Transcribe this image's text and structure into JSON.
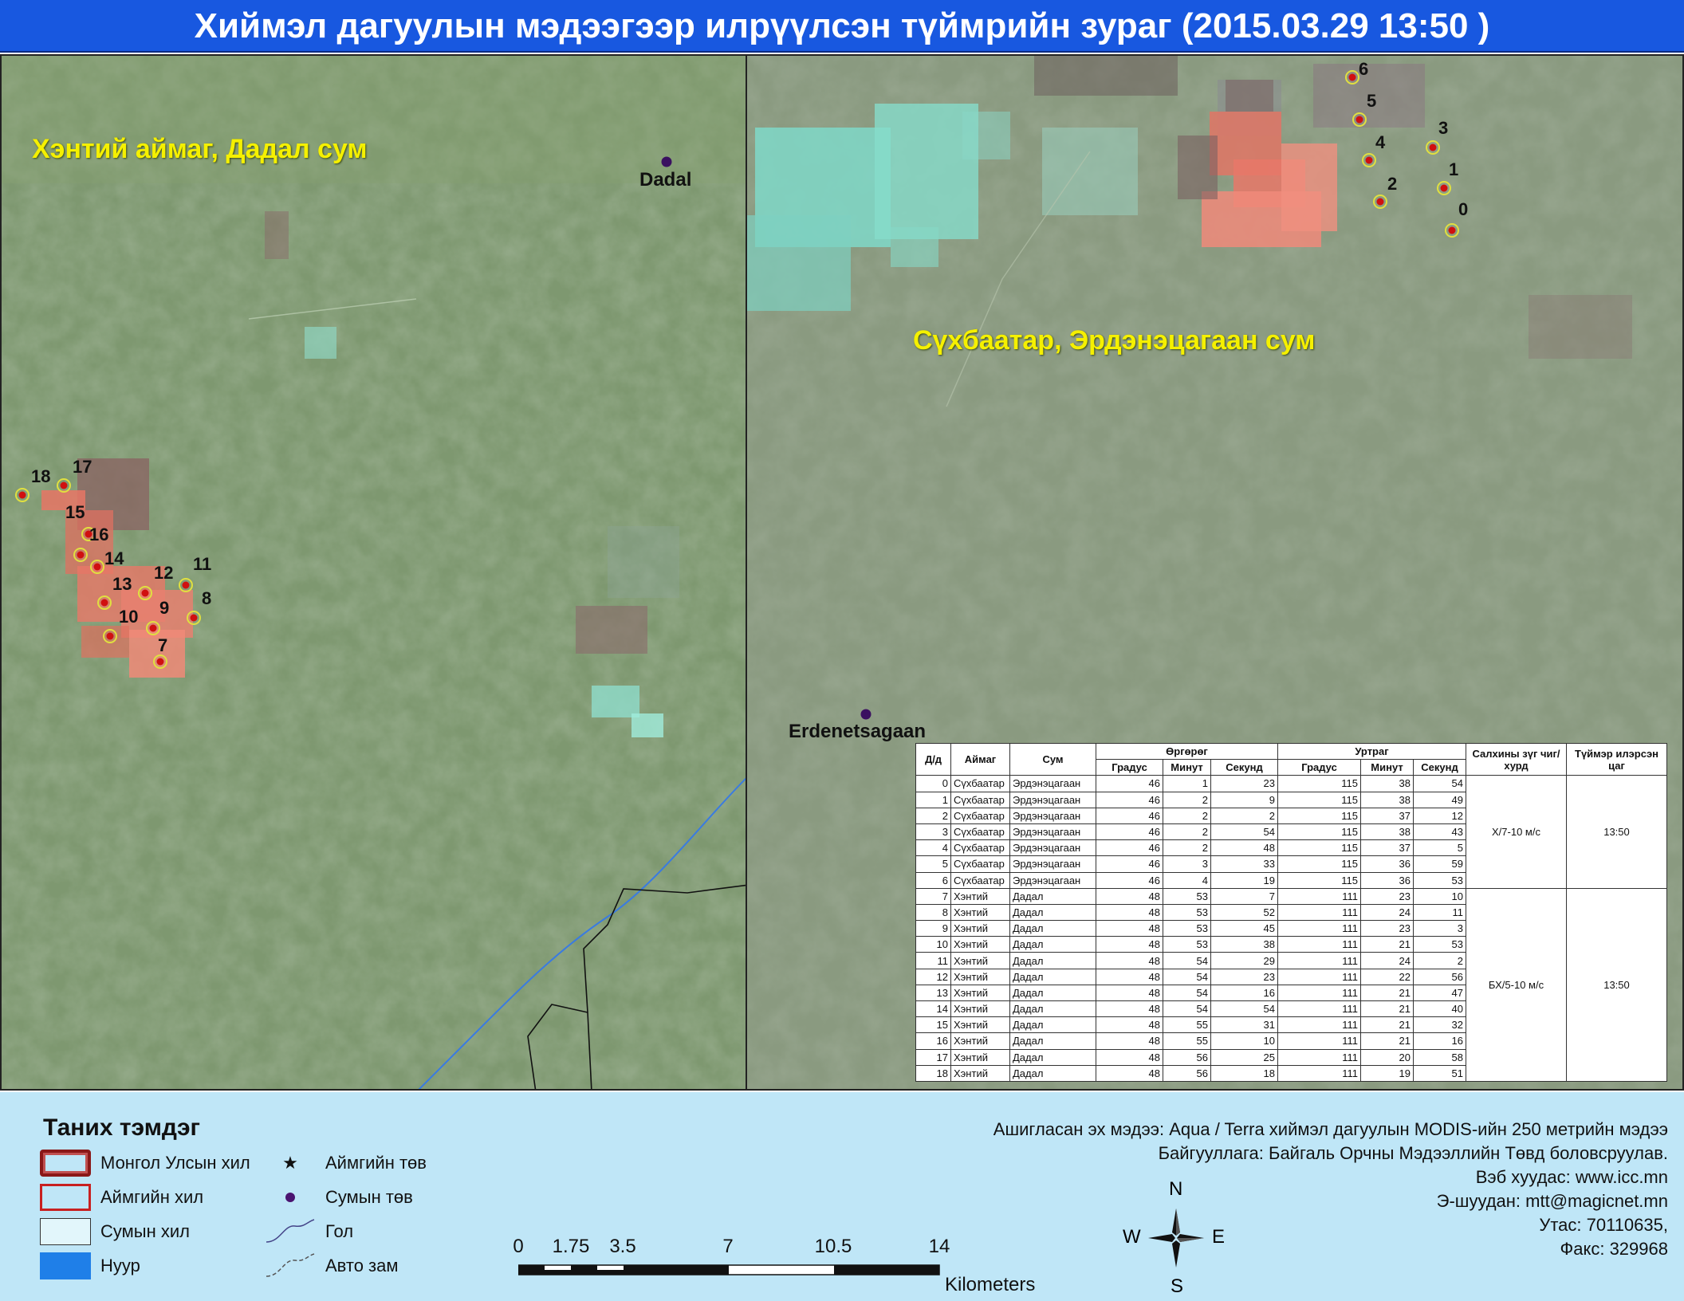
{
  "title": "Хиймэл дагуулын мэдээгээр илрүүлсэн түймрийн зураг  (2015.03.29 13:50 )",
  "map_left": {
    "region_label": "Хэнтий аймаг, Дадал сум",
    "town_label": "Dadal",
    "fire_labels": [
      "7",
      "8",
      "9",
      "10",
      "11",
      "12",
      "13",
      "14",
      "15",
      "16",
      "17",
      "18"
    ]
  },
  "map_right": {
    "region_label": "Сүхбаатар, Эрдэнэцагаан сум",
    "town_label": "Erdenetsagaan",
    "fire_labels": [
      "0",
      "1",
      "2",
      "3",
      "4",
      "5",
      "6"
    ]
  },
  "table": {
    "headers": {
      "id": "Д/д",
      "aimag": "Аймаг",
      "sum": "Сум",
      "lat": "Өргөрөг",
      "lon": "Уртраг",
      "deg": "Градус",
      "min": "Минут",
      "sec": "Секунд",
      "wind": "Салхины зүг чиг/хурд",
      "time": "Түймэр илэрсэн цаг"
    },
    "rows": [
      {
        "id": "0",
        "aimag": "Сүхбаатар",
        "sum": "Эрдэнэцагаан",
        "lat_d": "46",
        "lat_m": "1",
        "lat_s": "23",
        "lon_d": "115",
        "lon_m": "38",
        "lon_s": "54"
      },
      {
        "id": "1",
        "aimag": "Сүхбаатар",
        "sum": "Эрдэнэцагаан",
        "lat_d": "46",
        "lat_m": "2",
        "lat_s": "9",
        "lon_d": "115",
        "lon_m": "38",
        "lon_s": "49"
      },
      {
        "id": "2",
        "aimag": "Сүхбаатар",
        "sum": "Эрдэнэцагаан",
        "lat_d": "46",
        "lat_m": "2",
        "lat_s": "2",
        "lon_d": "115",
        "lon_m": "37",
        "lon_s": "12"
      },
      {
        "id": "3",
        "aimag": "Сүхбаатар",
        "sum": "Эрдэнэцагаан",
        "lat_d": "46",
        "lat_m": "2",
        "lat_s": "54",
        "lon_d": "115",
        "lon_m": "38",
        "lon_s": "43"
      },
      {
        "id": "4",
        "aimag": "Сүхбаатар",
        "sum": "Эрдэнэцагаан",
        "lat_d": "46",
        "lat_m": "2",
        "lat_s": "48",
        "lon_d": "115",
        "lon_m": "37",
        "lon_s": "5"
      },
      {
        "id": "5",
        "aimag": "Сүхбаатар",
        "sum": "Эрдэнэцагаан",
        "lat_d": "46",
        "lat_m": "3",
        "lat_s": "33",
        "lon_d": "115",
        "lon_m": "36",
        "lon_s": "59"
      },
      {
        "id": "6",
        "aimag": "Сүхбаатар",
        "sum": "Эрдэнэцагаан",
        "lat_d": "46",
        "lat_m": "4",
        "lat_s": "19",
        "lon_d": "115",
        "lon_m": "36",
        "lon_s": "53"
      },
      {
        "id": "7",
        "aimag": "Хэнтий",
        "sum": "Дадал",
        "lat_d": "48",
        "lat_m": "53",
        "lat_s": "7",
        "lon_d": "111",
        "lon_m": "23",
        "lon_s": "10"
      },
      {
        "id": "8",
        "aimag": "Хэнтий",
        "sum": "Дадал",
        "lat_d": "48",
        "lat_m": "53",
        "lat_s": "52",
        "lon_d": "111",
        "lon_m": "24",
        "lon_s": "11"
      },
      {
        "id": "9",
        "aimag": "Хэнтий",
        "sum": "Дадал",
        "lat_d": "48",
        "lat_m": "53",
        "lat_s": "45",
        "lon_d": "111",
        "lon_m": "23",
        "lon_s": "3"
      },
      {
        "id": "10",
        "aimag": "Хэнтий",
        "sum": "Дадал",
        "lat_d": "48",
        "lat_m": "53",
        "lat_s": "38",
        "lon_d": "111",
        "lon_m": "21",
        "lon_s": "53"
      },
      {
        "id": "11",
        "aimag": "Хэнтий",
        "sum": "Дадал",
        "lat_d": "48",
        "lat_m": "54",
        "lat_s": "29",
        "lon_d": "111",
        "lon_m": "24",
        "lon_s": "2"
      },
      {
        "id": "12",
        "aimag": "Хэнтий",
        "sum": "Дадал",
        "lat_d": "48",
        "lat_m": "54",
        "lat_s": "23",
        "lon_d": "111",
        "lon_m": "22",
        "lon_s": "56"
      },
      {
        "id": "13",
        "aimag": "Хэнтий",
        "sum": "Дадал",
        "lat_d": "48",
        "lat_m": "54",
        "lat_s": "16",
        "lon_d": "111",
        "lon_m": "21",
        "lon_s": "47"
      },
      {
        "id": "14",
        "aimag": "Хэнтий",
        "sum": "Дадал",
        "lat_d": "48",
        "lat_m": "54",
        "lat_s": "54",
        "lon_d": "111",
        "lon_m": "21",
        "lon_s": "40"
      },
      {
        "id": "15",
        "aimag": "Хэнтий",
        "sum": "Дадал",
        "lat_d": "48",
        "lat_m": "55",
        "lat_s": "31",
        "lon_d": "111",
        "lon_m": "21",
        "lon_s": "32"
      },
      {
        "id": "16",
        "aimag": "Хэнтий",
        "sum": "Дадал",
        "lat_d": "48",
        "lat_m": "55",
        "lat_s": "10",
        "lon_d": "111",
        "lon_m": "21",
        "lon_s": "16"
      },
      {
        "id": "17",
        "aimag": "Хэнтий",
        "sum": "Дадал",
        "lat_d": "48",
        "lat_m": "56",
        "lat_s": "25",
        "lon_d": "111",
        "lon_m": "20",
        "lon_s": "58"
      },
      {
        "id": "18",
        "aimag": "Хэнтий",
        "sum": "Дадал",
        "lat_d": "48",
        "lat_m": "56",
        "lat_s": "18",
        "lon_d": "111",
        "lon_m": "19",
        "lon_s": "51"
      }
    ],
    "group1": {
      "wind": "Х/7-10 м/с",
      "time": "13:50"
    },
    "group2": {
      "wind": "БХ/5-10 м/с",
      "time": "13:50"
    }
  },
  "legend": {
    "title": "Таних тэмдэг",
    "items": {
      "border_national": "Монгол Улсын хил",
      "border_aimag": "Аймгийн хил",
      "border_sum": "Сумын хил",
      "lake": "Нуур",
      "aimag_center": "Аймгийн төв",
      "sum_center": "Сумын төв",
      "river": "Гол",
      "road": "Авто зам"
    }
  },
  "scalebar": {
    "ticks": [
      "0",
      "1.75",
      "3.5",
      "7",
      "10.5",
      "14"
    ],
    "unit": "Kilometers"
  },
  "compass": {
    "n": "N",
    "s": "S",
    "e": "E",
    "w": "W"
  },
  "info": {
    "line1": "Ашигласан эх мэдээ: Aqua / Terra хиймэл дагуулын MODIS-ийн 250 метрийн мэдээ",
    "line2": "Байгууллага: Байгаль Орчны Мэдээллийн Төвд боловсруулав.",
    "line3": "Вэб хуудас: www.icc.mn",
    "line4": "Э-шуудан: mtt@magicnet.mn",
    "line5": "Утас: 70110635,",
    "line6": "Факс: 329968"
  },
  "colors": {
    "title_bg": "#1858e0",
    "map_base": "#7e9870",
    "fire_patch": "#e87060",
    "fire_dot": "#d01010",
    "label_yellow": "#f5f000",
    "legend_bg": "#bfe6f7",
    "river": "#3a7be0"
  }
}
